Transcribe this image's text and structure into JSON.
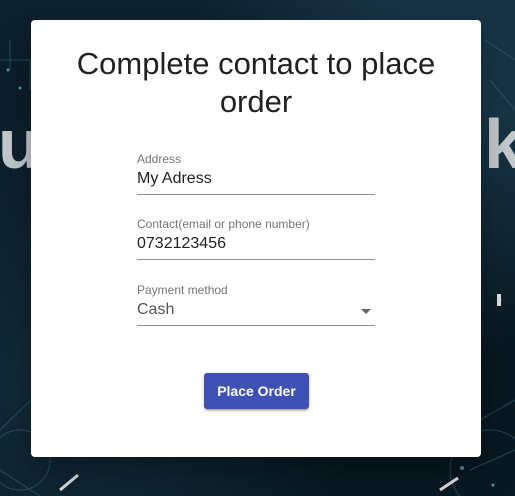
{
  "background": {
    "left_text": "u",
    "right_text": "k"
  },
  "dialog": {
    "title": "Complete contact to place order",
    "address": {
      "label": "Address",
      "value": "My Adress"
    },
    "contact": {
      "label": "Contact(email or phone number)",
      "value": "0732123456"
    },
    "payment": {
      "label": "Payment method",
      "value": "Cash",
      "icon": "chevron-down-icon"
    },
    "submit_label": "Place Order"
  },
  "colors": {
    "primary": "#3f51b5",
    "dialog_bg": "#ffffff",
    "backdrop": "#0b1a24"
  }
}
